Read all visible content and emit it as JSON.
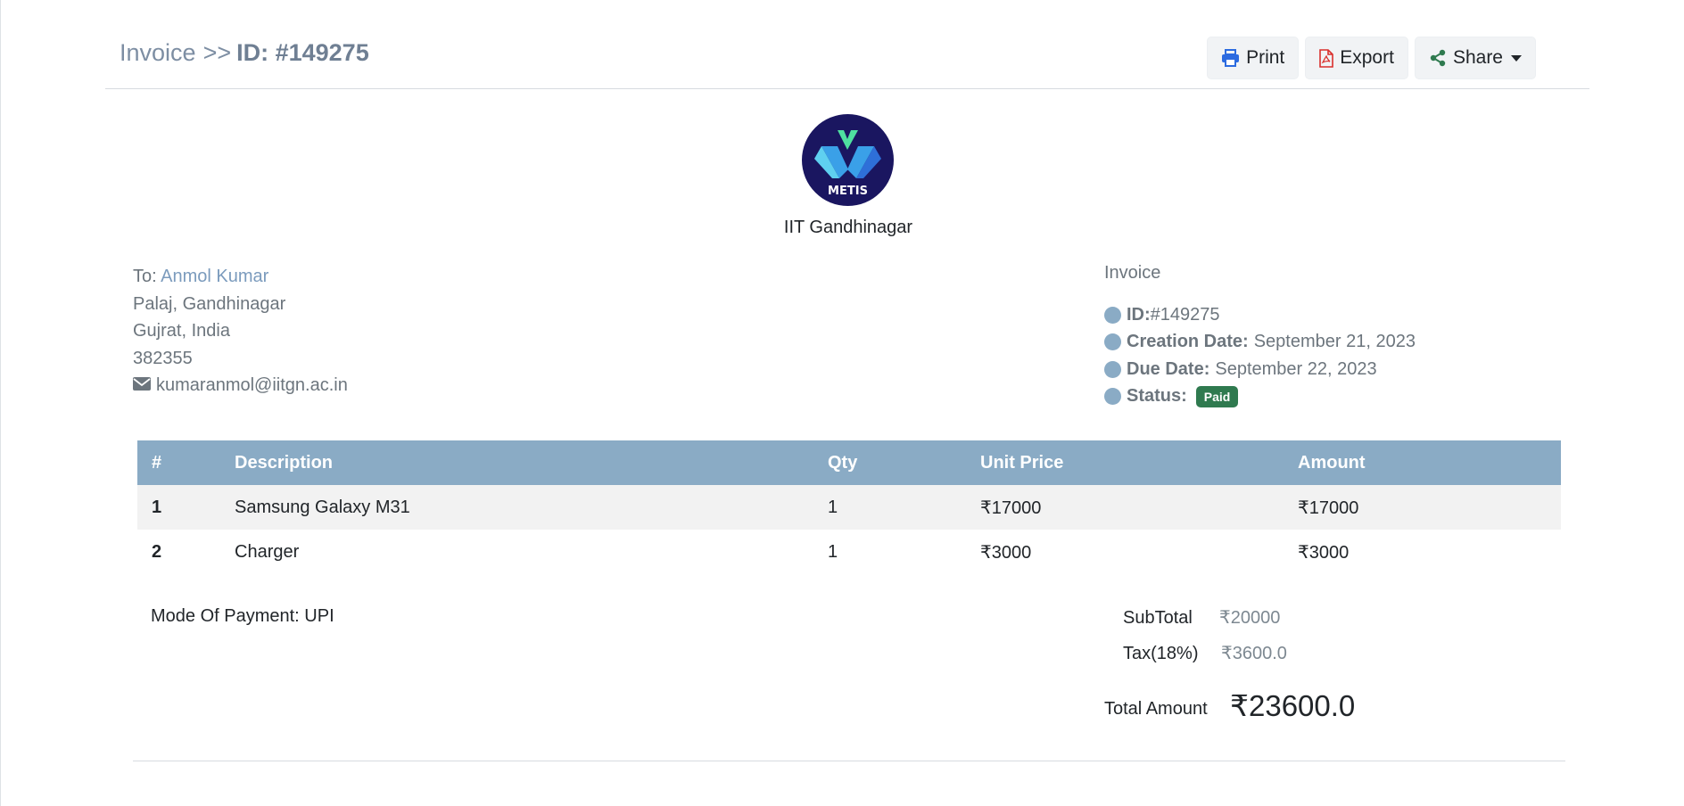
{
  "breadcrumb": {
    "parent": "Invoice",
    "separator": ">>",
    "current": "ID: #149275"
  },
  "toolbar": {
    "print_label": "Print",
    "export_label": "Export",
    "share_label": "Share"
  },
  "company": {
    "logo_text": "METIS",
    "name": "IIT Gandhinagar"
  },
  "recipient": {
    "to_prefix": "To:",
    "name": "Anmol Kumar",
    "address_line1": "Palaj, Gandhinagar",
    "address_line2": "Gujrat, India",
    "postal_code": "382355",
    "email": "kumaranmol@iitgn.ac.in"
  },
  "invoice": {
    "title": "Invoice",
    "id_label": "ID:",
    "id_value": "#149275",
    "creation_label": "Creation Date:",
    "creation_value": "September 21, 2023",
    "due_label": "Due Date:",
    "due_value": "September 22, 2023",
    "status_label": "Status:",
    "status_value": "Paid",
    "status_color": "#2f7a4f"
  },
  "table": {
    "headers": [
      "#",
      "Description",
      "Qty",
      "Unit Price",
      "Amount"
    ],
    "rows": [
      [
        "1",
        "Samsung Galaxy M31",
        "1",
        "₹17000",
        "₹17000"
      ],
      [
        "2",
        "Charger",
        "1",
        "₹3000",
        "₹3000"
      ]
    ],
    "header_color": "#8aabc5"
  },
  "payment": {
    "mode_text": "Mode Of Payment: UPI"
  },
  "totals": {
    "subtotal_label": "SubTotal",
    "subtotal_value": "₹20000",
    "tax_label": "Tax(18%)",
    "tax_value": "₹3600.0",
    "total_label": "Total Amount",
    "total_value": "₹23600.0"
  },
  "icons": {
    "print": "printer-icon",
    "export": "pdf-file-icon",
    "share": "share-icon",
    "email": "envelope-icon",
    "dropdown": "caret-down-icon"
  },
  "colors": {
    "accent": "#8aabc5",
    "link": "#7b9bbd",
    "logo_bg": "#1a1660"
  }
}
